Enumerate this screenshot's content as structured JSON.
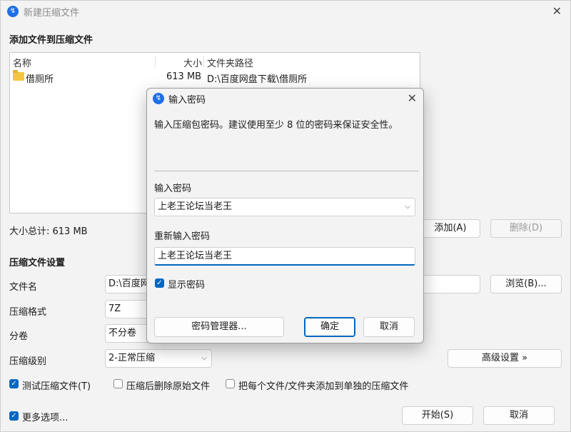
{
  "window": {
    "title": "新建压缩文件",
    "close_glyph": "✕"
  },
  "add_section": {
    "title": "添加文件到压缩文件"
  },
  "filelist": {
    "columns": {
      "name": "名称",
      "size": "大小",
      "path": "文件夹路径"
    },
    "rows": [
      {
        "name": "借厕所",
        "size": "613 MB",
        "path": "D:\\百度网盘下载\\借厕所"
      }
    ]
  },
  "total_size": "大小总计: 613 MB",
  "list_buttons": {
    "add": "添加(A)",
    "remove": "删除(D)"
  },
  "settings": {
    "title": "压缩文件设置",
    "filename_label": "文件名",
    "filename_value": "D:\\百度网",
    "browse": "浏览(B)...",
    "format_label": "压缩格式",
    "format_value": "7Z",
    "split_label": "分卷",
    "split_value": "不分卷",
    "level_label": "压缩级别",
    "level_value": "2-正常压缩",
    "advanced": "高级设置 »"
  },
  "options": {
    "test": "测试压缩文件(T)",
    "delete_after": "压缩后删除原始文件",
    "each_separate": "把每个文件/文件夹添加到单独的压缩文件",
    "more": "更多选项..."
  },
  "footer": {
    "start": "开始(S)",
    "cancel": "取消"
  },
  "dialog": {
    "title": "输入密码",
    "description": "输入压缩包密码。建议使用至少 8 位的密码来保证安全性。",
    "pw_label": "输入密码",
    "pw_value": "上老王论坛当老王",
    "pw2_label": "重新输入密码",
    "pw2_value": "上老王论坛当老王",
    "show_password": "显示密码",
    "manager": "密码管理器...",
    "ok": "确定",
    "cancel": "取消"
  },
  "icons": {
    "app": "app-logo-icon",
    "folder": "folder-icon",
    "check": "checkmark-icon",
    "dropdown": "chevron-down-icon"
  },
  "colors": {
    "accent": "#0067c0",
    "app_icon": "#1f6fe5",
    "folder": "#f4c542"
  }
}
